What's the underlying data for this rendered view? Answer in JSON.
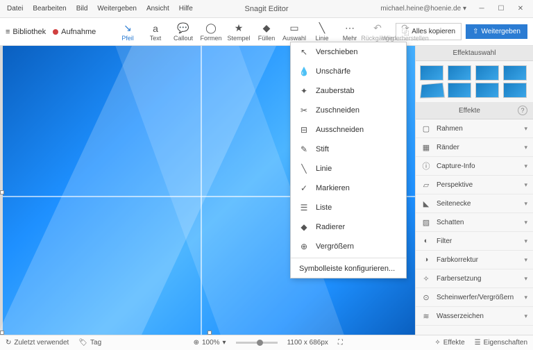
{
  "titlebar": {
    "menus": [
      "Datei",
      "Bearbeiten",
      "Bild",
      "Weitergeben",
      "Ansicht",
      "Hilfe"
    ],
    "app_title": "Snagit Editor",
    "user_email": "michael.heine@hoenie.de",
    "dropdown_glyph": "▾",
    "min": "─",
    "max": "☐",
    "close": "✕"
  },
  "secondbar": {
    "library_icon": "≡",
    "library": "Bibliothek",
    "record": "Aufnahme",
    "tools": [
      {
        "icon": "↘",
        "label": "Pfeil"
      },
      {
        "icon": "a",
        "label": "Text"
      },
      {
        "icon": "💬",
        "label": "Callout"
      },
      {
        "icon": "◯",
        "label": "Formen"
      },
      {
        "icon": "★",
        "label": "Stempel"
      },
      {
        "icon": "◆",
        "label": "Füllen"
      },
      {
        "icon": "▭",
        "label": "Auswahl"
      },
      {
        "icon": "╲",
        "label": "Linie"
      },
      {
        "icon": "⋯",
        "label": "Mehr"
      }
    ],
    "undo": {
      "icon": "↶",
      "label": "Rückgängig"
    },
    "redo": {
      "icon": "↷",
      "label": "Wiederherstellen"
    },
    "copy_all": "Alles kopieren",
    "copy_icon": "⿻",
    "share": "Weitergeben",
    "share_icon": "⇧"
  },
  "dropdown": {
    "items": [
      {
        "icon": "↖",
        "label": "Verschieben"
      },
      {
        "icon": "💧",
        "label": "Unschärfe"
      },
      {
        "icon": "✦",
        "label": "Zauberstab"
      },
      {
        "icon": "✂",
        "label": "Zuschneiden"
      },
      {
        "icon": "⊟",
        "label": "Ausschneiden"
      },
      {
        "icon": "✎",
        "label": "Stift"
      },
      {
        "icon": "╲",
        "label": "Linie"
      },
      {
        "icon": "✓",
        "label": "Markieren"
      },
      {
        "icon": "☰",
        "label": "Liste"
      },
      {
        "icon": "◆",
        "label": "Radierer"
      },
      {
        "icon": "⊕",
        "label": "Vergrößern"
      }
    ],
    "configure": "Symbolleiste konfigurieren..."
  },
  "sidebar": {
    "effect_selection": "Effektauswahl",
    "effects_header": "Effekte",
    "help": "?",
    "effects": [
      {
        "icon": "▢",
        "label": "Rahmen"
      },
      {
        "icon": "▦",
        "label": "Ränder"
      },
      {
        "icon": "ⓘ",
        "label": "Capture-Info"
      },
      {
        "icon": "▱",
        "label": "Perspektive"
      },
      {
        "icon": "◣",
        "label": "Seitenecke"
      },
      {
        "icon": "▨",
        "label": "Schatten"
      },
      {
        "icon": "◐",
        "label": "Filter"
      },
      {
        "icon": "◑",
        "label": "Farbkorrektur"
      },
      {
        "icon": "✧",
        "label": "Farbersetzung"
      },
      {
        "icon": "⊙",
        "label": "Scheinwerfer/Vergrößern"
      },
      {
        "icon": "≋",
        "label": "Wasserzeichen"
      }
    ]
  },
  "statusbar": {
    "recent_icon": "↻",
    "recent": "Zuletzt verwendet",
    "tag_icon": "🏷",
    "tag": "Tag",
    "zoom_icon": "⊕",
    "zoom": "100%",
    "dims": "1100 x 686px",
    "fit_icon": "⛶",
    "effects_icon": "✧",
    "effects": "Effekte",
    "props_icon": "☰",
    "props": "Eigenschaften"
  }
}
